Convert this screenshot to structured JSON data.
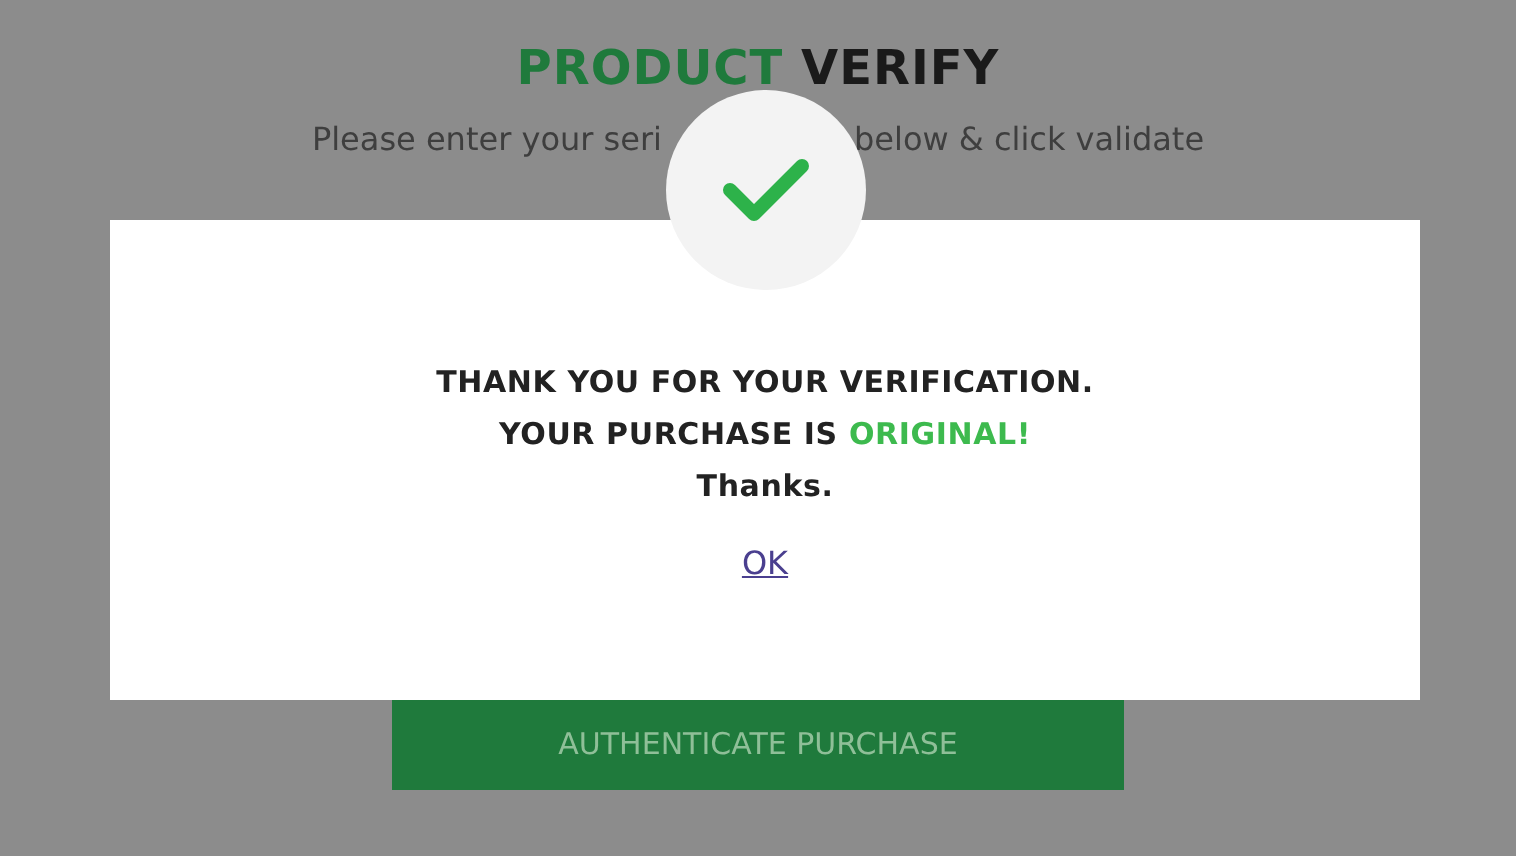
{
  "page": {
    "title_accent": "PRODUCT",
    "title_rest": "VERIFY",
    "subtitle_parts": [
      "Please enter your seri",
      "below & click validate"
    ],
    "submit_button": "AUTHENTICATE PURCHASE"
  },
  "dialog": {
    "lines": [
      {
        "text": "THANK YOU FOR YOUR VERIFICATION."
      },
      {
        "text": "YOUR PURCHASE IS",
        "highlight": "ORIGINAL!"
      },
      {
        "text": "Thanks."
      }
    ],
    "link": "OK"
  }
}
